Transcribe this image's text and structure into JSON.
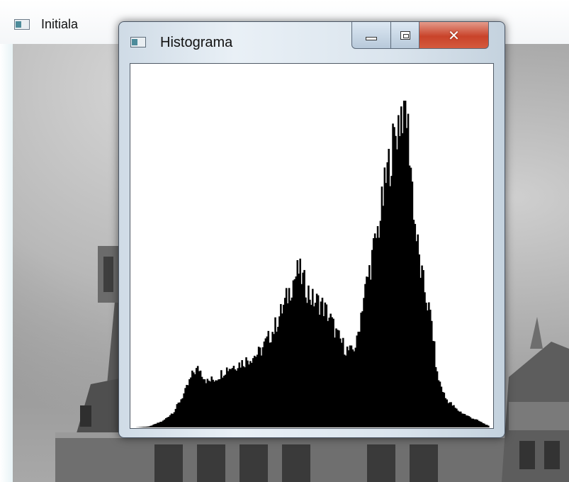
{
  "background_window": {
    "title": "Initiala",
    "icon": "window-app-icon"
  },
  "histogram_window": {
    "title": "Histograma",
    "icon": "window-app-icon",
    "buttons": {
      "minimize": "minimize-icon",
      "maximize": "maximize-icon",
      "close": "close-icon"
    }
  },
  "chart_data": {
    "type": "bar",
    "title": "",
    "xlabel": "",
    "ylabel": "",
    "xlim": [
      0,
      255
    ],
    "ylim": [
      0,
      1
    ],
    "grid": false,
    "bar_color": "#000000",
    "background": "#ffffff",
    "note_values": "relative pixel count per gray level, peak normalized to 1",
    "keypoints": [
      [
        0,
        0.0
      ],
      [
        10,
        0.003
      ],
      [
        20,
        0.02
      ],
      [
        28,
        0.05
      ],
      [
        36,
        0.11
      ],
      [
        42,
        0.17
      ],
      [
        46,
        0.18
      ],
      [
        52,
        0.14
      ],
      [
        58,
        0.15
      ],
      [
        66,
        0.18
      ],
      [
        78,
        0.2
      ],
      [
        90,
        0.23
      ],
      [
        100,
        0.3
      ],
      [
        108,
        0.38
      ],
      [
        114,
        0.45
      ],
      [
        118,
        0.48
      ],
      [
        122,
        0.44
      ],
      [
        128,
        0.39
      ],
      [
        134,
        0.38
      ],
      [
        140,
        0.34
      ],
      [
        146,
        0.28
      ],
      [
        152,
        0.24
      ],
      [
        156,
        0.23
      ],
      [
        160,
        0.26
      ],
      [
        164,
        0.38
      ],
      [
        170,
        0.5
      ],
      [
        176,
        0.62
      ],
      [
        182,
        0.78
      ],
      [
        188,
        0.9
      ],
      [
        192,
        0.97
      ],
      [
        195,
        1.0
      ],
      [
        198,
        0.86
      ],
      [
        202,
        0.62
      ],
      [
        206,
        0.48
      ],
      [
        210,
        0.4
      ],
      [
        214,
        0.32
      ],
      [
        218,
        0.16
      ],
      [
        224,
        0.09
      ],
      [
        232,
        0.055
      ],
      [
        240,
        0.035
      ],
      [
        248,
        0.02
      ],
      [
        255,
        0.005
      ]
    ]
  }
}
